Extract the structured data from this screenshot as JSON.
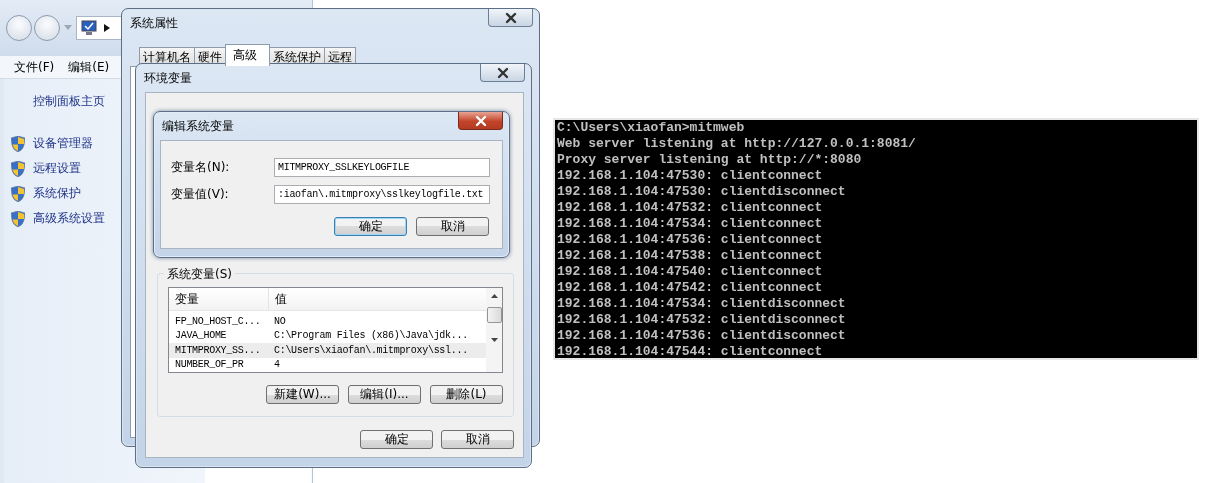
{
  "control_panel": {
    "menu": [
      "文件(F)",
      "编辑(E)"
    ],
    "home_link": "控制面板主页",
    "tasks": [
      "设备管理器",
      "远程设置",
      "系统保护",
      "高级系统设置"
    ]
  },
  "system_properties": {
    "title": "系统属性",
    "tabs": [
      {
        "label": "计算机名",
        "selected": false
      },
      {
        "label": "硬件",
        "selected": false
      },
      {
        "label": "高级",
        "selected": true
      },
      {
        "label": "系统保护",
        "selected": false
      },
      {
        "label": "远程",
        "selected": false
      }
    ]
  },
  "environment_variables": {
    "title": "环境变量",
    "system_variables": {
      "legend": "系统变量(S)",
      "columns": [
        "变量",
        "值"
      ],
      "rows": [
        {
          "name": "FP_NO_HOST_C...",
          "value": "NO",
          "selected": false
        },
        {
          "name": "JAVA_HOME",
          "value": "C:\\Program Files (x86)\\Java\\jdk...",
          "selected": false
        },
        {
          "name": "MITMPROXY_SS...",
          "value": "C:\\Users\\xiaofan\\.mitmproxy\\ssl...",
          "selected": true
        },
        {
          "name": "NUMBER_OF_PR",
          "value": "4",
          "selected": false
        }
      ],
      "buttons": [
        "新建(W)...",
        "编辑(I)...",
        "删除(L)"
      ]
    },
    "buttons": [
      {
        "label": "确定",
        "default": false
      },
      {
        "label": "取消",
        "default": false
      }
    ]
  },
  "edit_dialog": {
    "title": "编辑系统变量",
    "fields": [
      {
        "label": "变量名(N):",
        "value": "MITMPROXY_SSLKEYLOGFILE"
      },
      {
        "label": "变量值(V):",
        "value": ":iaofan\\.mitmproxy\\sslkeylogfile.txt"
      }
    ],
    "buttons": [
      {
        "label": "确定",
        "default": true
      },
      {
        "label": "取消",
        "default": false
      }
    ]
  },
  "console": {
    "lines": [
      "C:\\Users\\xiaofan>mitmweb",
      "Web server listening at http://127.0.0.1:8081/",
      "Proxy server listening at http://*:8080",
      "192.168.1.104:47530: clientconnect",
      "192.168.1.104:47530: clientdisconnect",
      "192.168.1.104:47532: clientconnect",
      "192.168.1.104:47534: clientconnect",
      "192.168.1.104:47536: clientconnect",
      "192.168.1.104:47538: clientconnect",
      "192.168.1.104:47540: clientconnect",
      "192.168.1.104:47542: clientconnect",
      "192.168.1.104:47534: clientdisconnect",
      "192.168.1.104:47532: clientdisconnect",
      "192.168.1.104:47536: clientdisconnect",
      "192.168.1.104:47544: clientconnect"
    ]
  }
}
